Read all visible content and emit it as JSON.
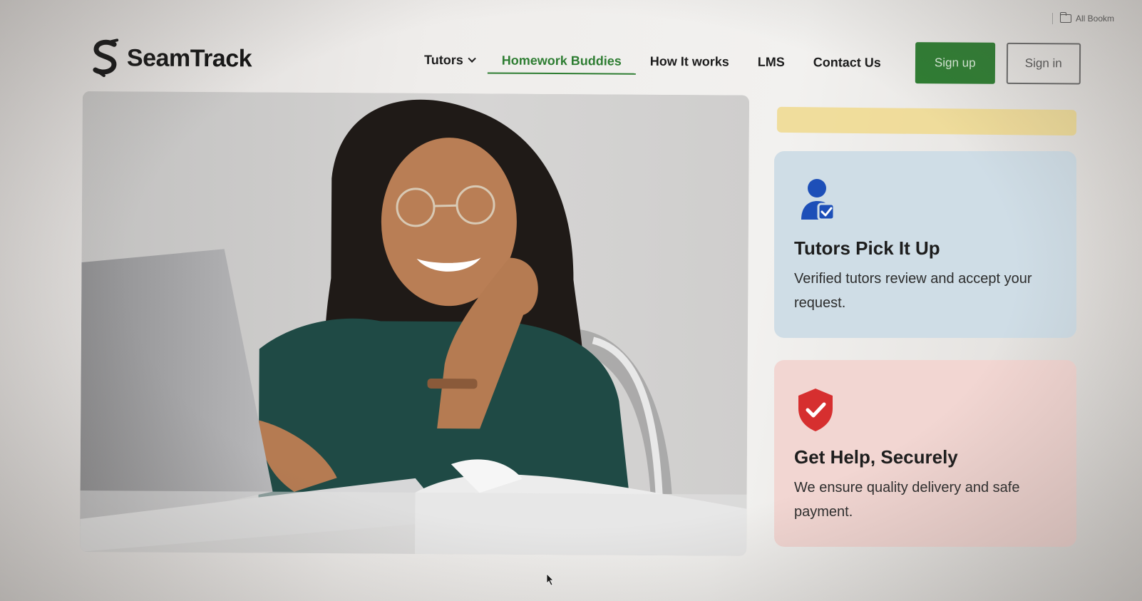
{
  "bookmarks": {
    "all_bookmarks_label": "All Bookm"
  },
  "brand": {
    "name": "SeamTrack",
    "accent_color": "#2e7d32"
  },
  "nav": {
    "items": [
      {
        "label": "Tutors",
        "has_dropdown": true,
        "active": false
      },
      {
        "label": "Homework Buddies",
        "active": true
      },
      {
        "label": "How It works",
        "active": false
      },
      {
        "label": "LMS",
        "active": false
      },
      {
        "label": "Contact Us",
        "active": false
      }
    ],
    "signup_label": "Sign up",
    "signin_label": "Sign in"
  },
  "hero": {
    "image_subject": "smiling student with laptop"
  },
  "cards": [
    {
      "icon": "verified-user-icon",
      "title": "Tutors Pick It Up",
      "text": "Verified tutors review and accept your request.",
      "color": "#cfdde6"
    },
    {
      "icon": "shield-check-icon",
      "title": "Get Help, Securely",
      "text": "We ensure quality delivery and safe payment.",
      "color": "#f2d6d2"
    }
  ],
  "accent_bar_color": "#f0d98d"
}
